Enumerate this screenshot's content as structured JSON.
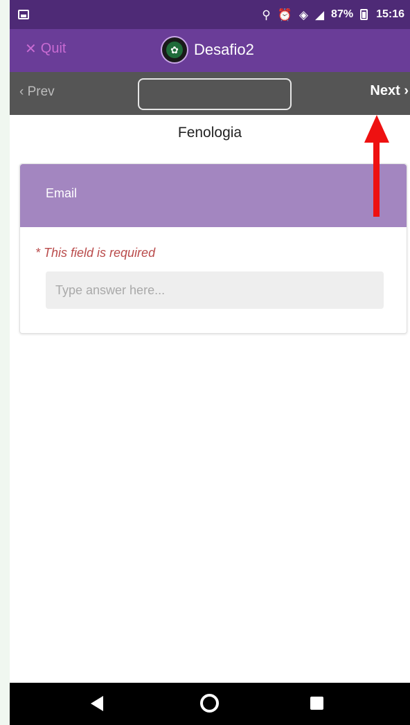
{
  "status_bar": {
    "battery_percent": "87%",
    "time": "15:16",
    "icons": [
      "image-icon",
      "location-icon",
      "alarm-icon",
      "wifi-icon",
      "signal-icon",
      "battery-icon"
    ]
  },
  "app_bar": {
    "quit_label": "Quit",
    "title": "Desafio2"
  },
  "nav": {
    "prev_label": "Prev",
    "next_label": "Next",
    "page_field_value": ""
  },
  "section": {
    "title": "Fenologia"
  },
  "question": {
    "label": "Email",
    "required_text": "* This field is required",
    "placeholder": "Type answer here...",
    "value": ""
  },
  "colors": {
    "status_bar": "#4e2a76",
    "app_bar": "#6a3d98",
    "nav_bar": "#555555",
    "card_header": "#a386c0",
    "required_text": "#b94a4a",
    "annotation_arrow": "#ee1111"
  }
}
